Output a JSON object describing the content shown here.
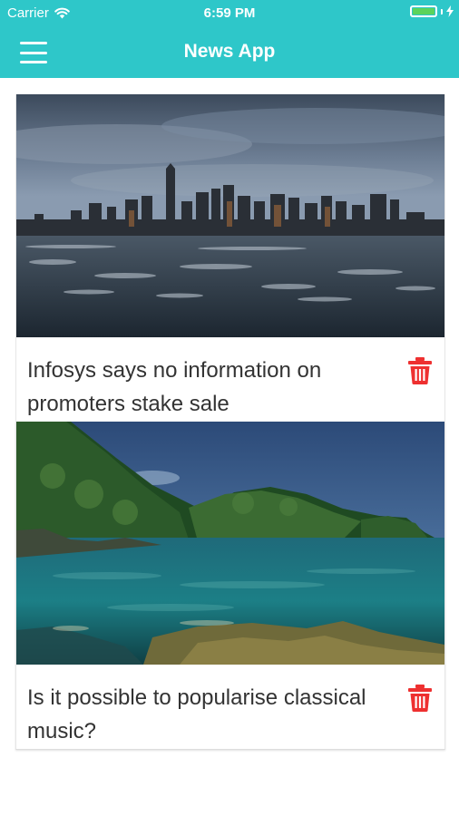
{
  "status_bar": {
    "carrier": "Carrier",
    "time": "6:59 PM",
    "battery_level": 1.0,
    "battery_color": "#5bd35b"
  },
  "nav_bar": {
    "title": "News App",
    "background": "#2ec7c9",
    "menu_icon": "hamburger-menu-icon"
  },
  "articles": [
    {
      "headline": "Infosys says no information on promoters stake sale",
      "image": "city-skyline-over-water-photo",
      "delete_icon": "trash-icon"
    },
    {
      "headline": "Is it possible to popularise classical music?",
      "image": "green-coastline-bay-photo",
      "delete_icon": "trash-icon"
    }
  ],
  "accent_colors": {
    "delete": "#ee3030",
    "text": "#333333"
  }
}
